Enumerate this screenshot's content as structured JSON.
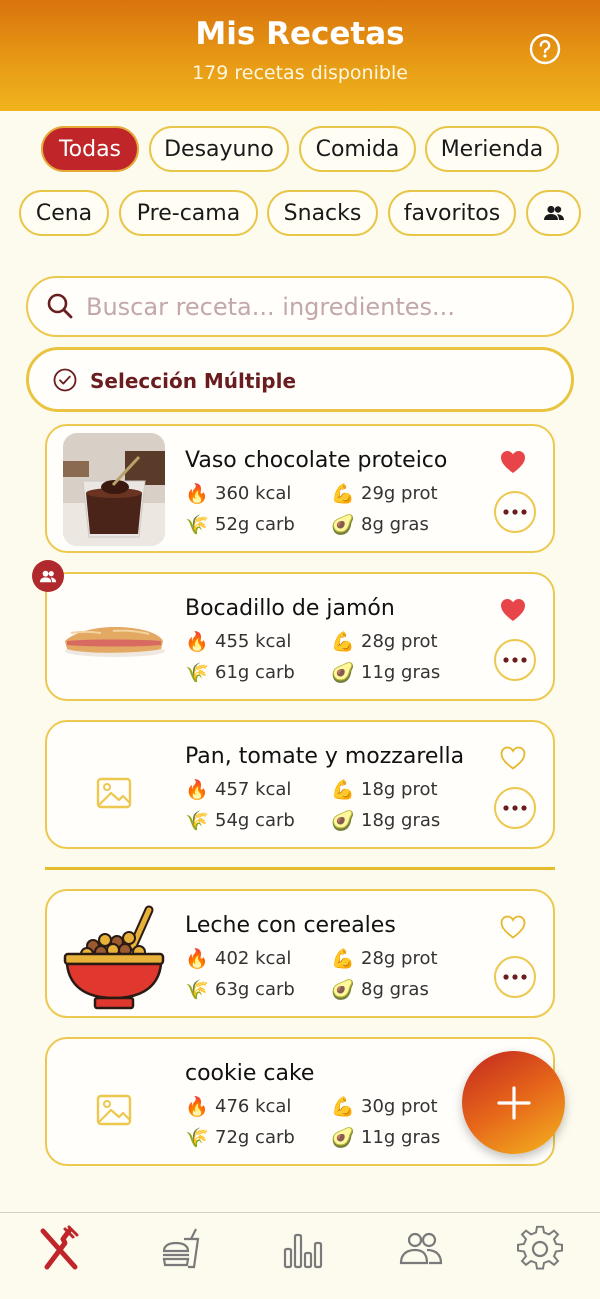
{
  "header": {
    "title": "Mis Recetas",
    "subtitle": "179 recetas disponible",
    "help_icon": "question-circle-icon"
  },
  "filters": [
    {
      "label": "Todas",
      "active": true
    },
    {
      "label": "Desayuno",
      "active": false
    },
    {
      "label": "Comida",
      "active": false
    },
    {
      "label": "Merienda",
      "active": false
    },
    {
      "label": "Cena",
      "active": false
    },
    {
      "label": "Pre-cama",
      "active": false
    },
    {
      "label": "Snacks",
      "active": false
    },
    {
      "label": "favoritos",
      "active": false
    },
    {
      "icon": "people-icon",
      "active": false
    }
  ],
  "search": {
    "placeholder": "Buscar receta... ingredientes..."
  },
  "multi_select": {
    "label": "Selección Múltiple"
  },
  "recipes": [
    {
      "name": "Vaso chocolate proteico",
      "kcal": "360 kcal",
      "prot": "29g prot",
      "carb": "52g carb",
      "fat": "8g gras",
      "favorite": true,
      "image": "chocolate-glass"
    },
    {
      "name": "Bocadillo de jamón",
      "kcal": "455 kcal",
      "prot": "28g prot",
      "carb": "61g carb",
      "fat": "11g gras",
      "favorite": true,
      "image": "sandwich",
      "shared": true
    },
    {
      "name": "Pan, tomate y mozzarella",
      "kcal": "457 kcal",
      "prot": "18g prot",
      "carb": "54g carb",
      "fat": "18g gras",
      "favorite": false,
      "image": "placeholder"
    },
    {
      "name": "Leche con cereales",
      "kcal": "402 kcal",
      "prot": "28g prot",
      "carb": "63g carb",
      "fat": "8g gras",
      "favorite": false,
      "image": "cereal-bowl"
    },
    {
      "name": "cookie cake",
      "kcal": "476 kcal",
      "prot": "30g prot",
      "carb": "72g carb",
      "fat": "11g gras",
      "favorite": false,
      "image": "placeholder"
    }
  ],
  "macro_icons": {
    "kcal": "🔥",
    "prot": "💪",
    "carb": "🌾",
    "fat": "🥑"
  },
  "tabs": [
    {
      "name": "recipes",
      "icon": "fork-knife-icon",
      "active": true
    },
    {
      "name": "meals",
      "icon": "fast-food-icon",
      "active": false
    },
    {
      "name": "stats",
      "icon": "bar-chart-icon",
      "active": false
    },
    {
      "name": "community",
      "icon": "users-icon",
      "active": false
    },
    {
      "name": "settings",
      "icon": "gear-icon",
      "active": false
    }
  ],
  "colors": {
    "accent": "#c0252a",
    "border": "#ecc84f",
    "background": "#fdfbee"
  }
}
